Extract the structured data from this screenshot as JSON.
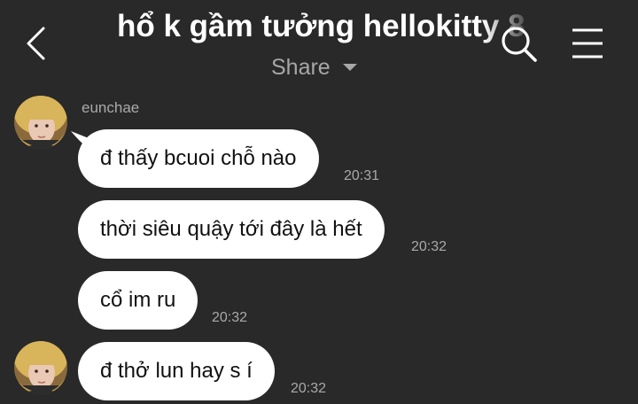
{
  "header": {
    "title": "hổ k gầm tưởng hellokitty 8",
    "subtitle": "Share",
    "back_icon": "chevron-left-icon",
    "search_icon": "search-icon",
    "menu_icon": "hamburger-menu-icon"
  },
  "messages": [
    {
      "sender": "eunchae",
      "text": "đ thấy bcuoi chỗ nào",
      "time": "20:31"
    },
    {
      "text": "thời siêu quậy tới đây là hết",
      "time": "20:32"
    },
    {
      "text": "cổ im ru",
      "time": "20:32"
    },
    {
      "text": "đ thở lun hay s í",
      "time": "20:32"
    }
  ],
  "colors": {
    "background": "#292929",
    "bubble": "#ffffff",
    "muted_text": "#a9a9a9"
  }
}
